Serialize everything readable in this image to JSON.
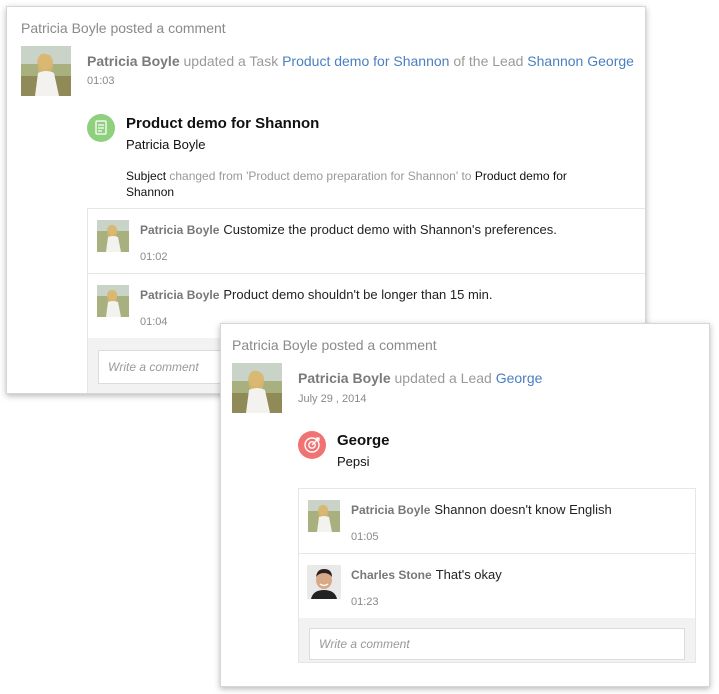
{
  "card1": {
    "header": "Patricia Boyle posted a comment",
    "activity": {
      "actor": "Patricia Boyle",
      "verb": " updated a Task ",
      "record_link": "Product demo for Shannon",
      "mid": " of the Lead ",
      "lead_link": "Shannon George"
    },
    "time": "01:03",
    "record": {
      "icon": "task-icon",
      "title": "Product demo for Shannon",
      "owner": "Patricia Boyle"
    },
    "change": {
      "field": "Subject",
      "text": " changed from 'Product demo preparation for Shannon' to ",
      "new_value": "Product demo for Shannon"
    },
    "comments": [
      {
        "author": "Patricia Boyle",
        "text": "Customize the product demo with Shannon's preferences.",
        "time": "01:02"
      },
      {
        "author": "Patricia Boyle",
        "text": "Product demo shouldn't be longer than 15 min.",
        "time": "01:04"
      }
    ],
    "write_placeholder": "Write a comment"
  },
  "card2": {
    "header": "Patricia Boyle posted a comment",
    "activity": {
      "actor": "Patricia Boyle",
      "verb": " updated a Lead ",
      "lead_link": "George"
    },
    "time": "July 29 , 2014",
    "record": {
      "icon": "lead-target-icon",
      "title": "George",
      "company": "Pepsi"
    },
    "comments": [
      {
        "author": "Patricia Boyle",
        "text": "Shannon doesn't know English",
        "time": "01:05"
      },
      {
        "author": "Charles Stone",
        "text": "That's okay",
        "time": "01:23"
      }
    ],
    "write_placeholder": "Write a comment"
  },
  "colors": {
    "link": "#4a7fc1",
    "task_icon": "#8fd07f",
    "lead_icon": "#f07272"
  }
}
